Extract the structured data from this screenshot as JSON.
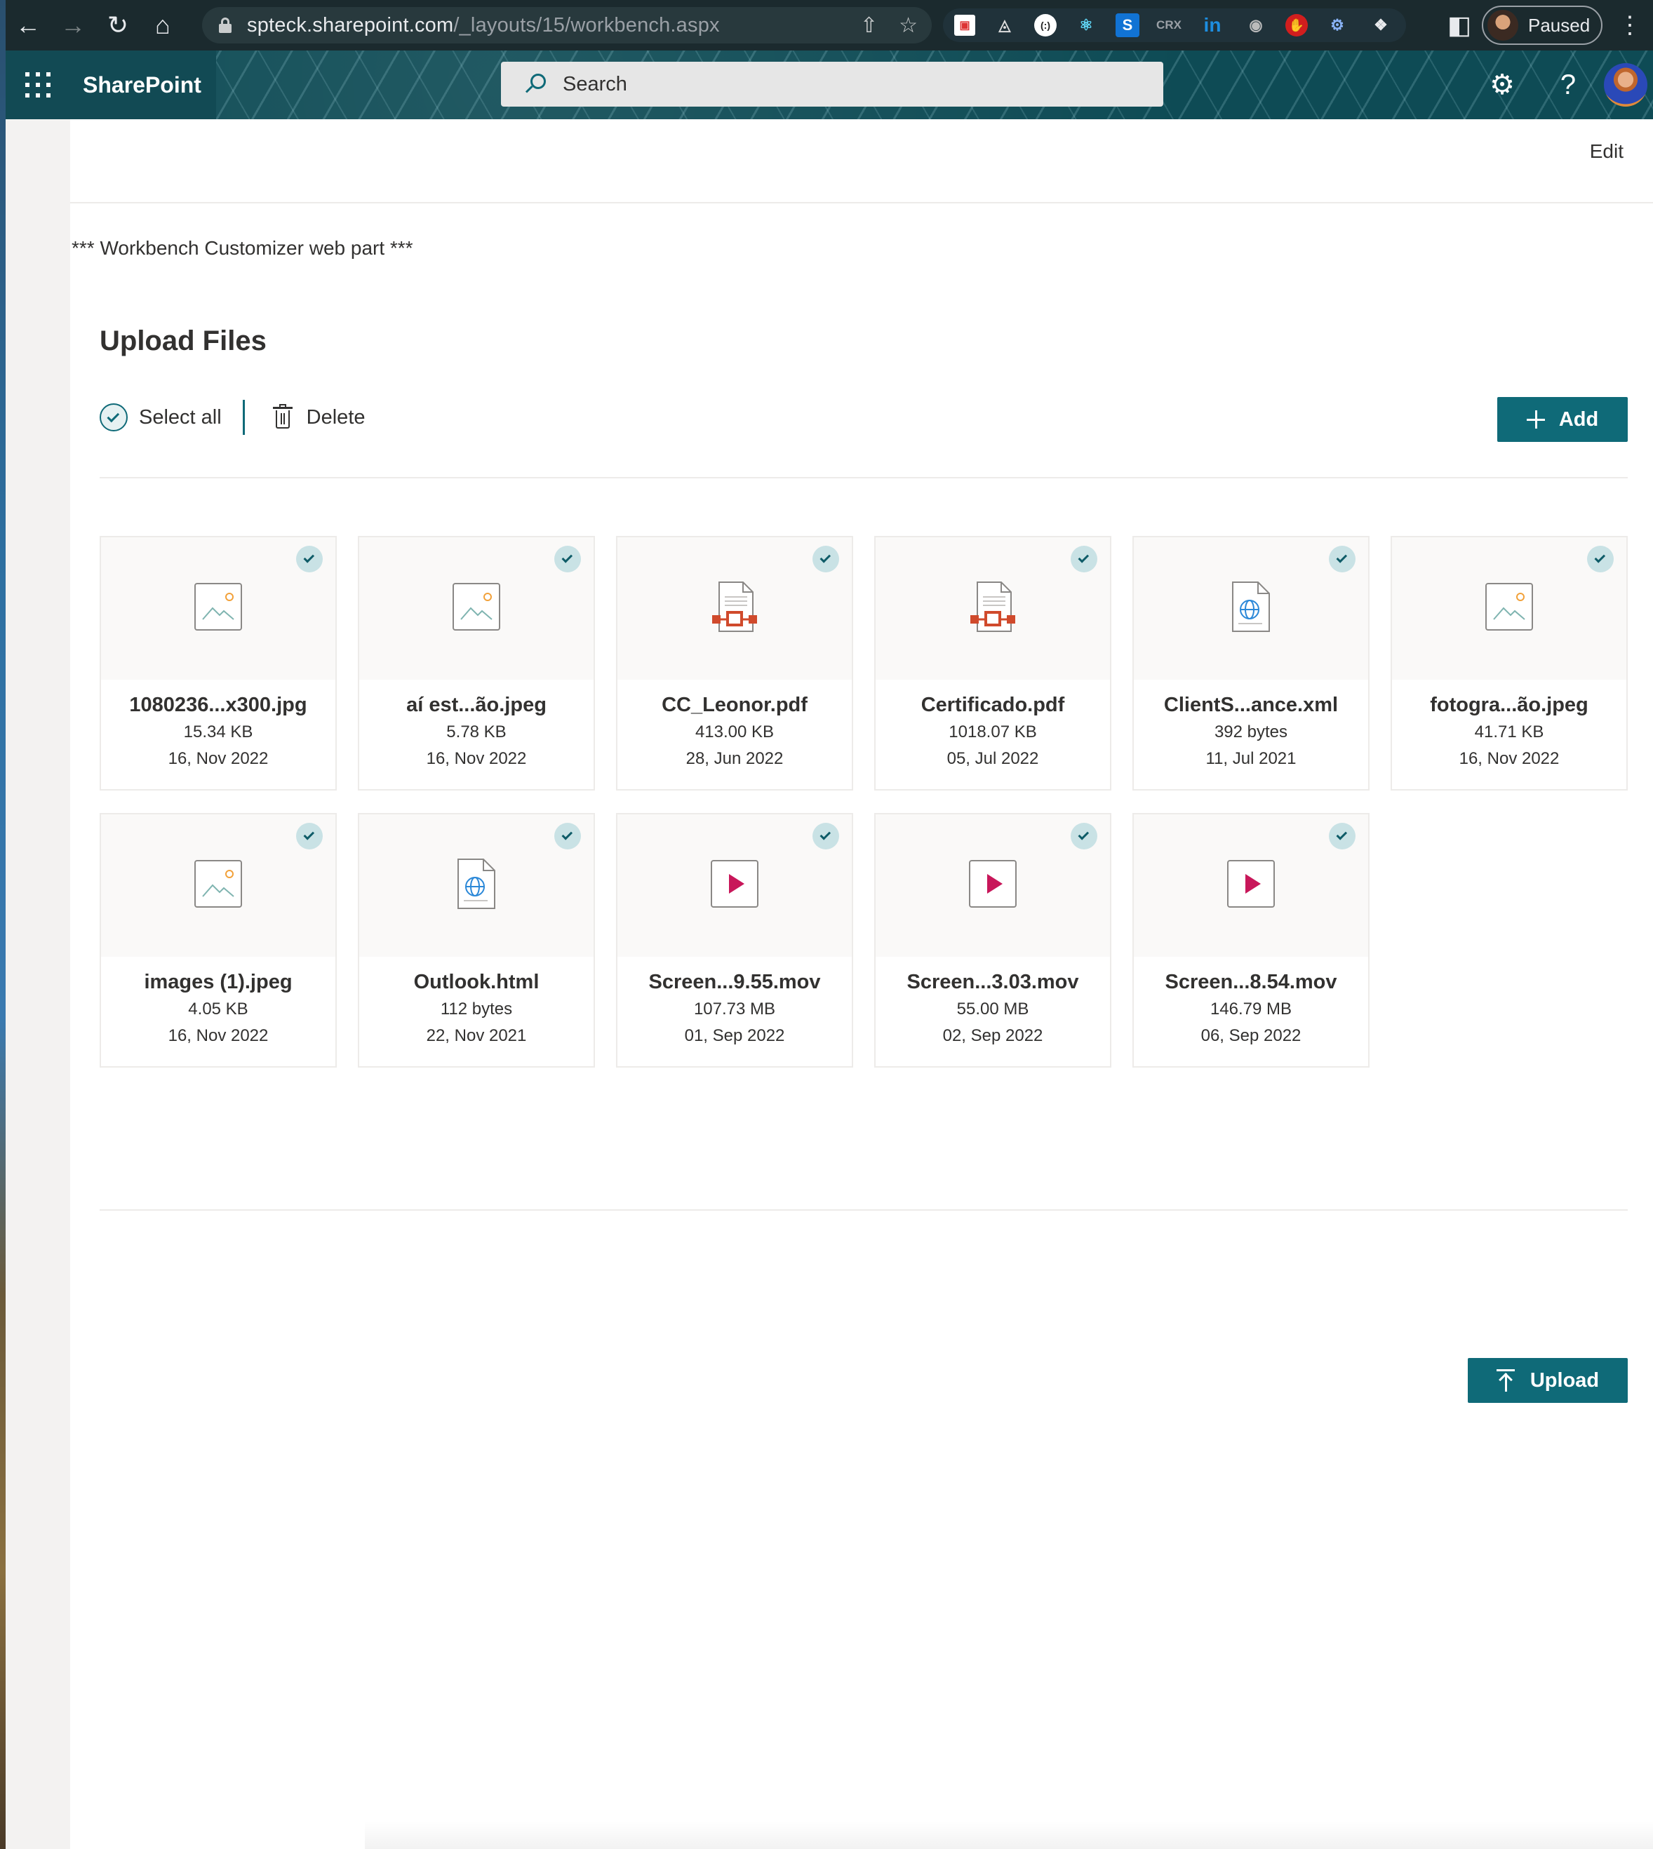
{
  "browser": {
    "url_host": "spteck.sharepoint.com",
    "url_path": "/_layouts/15/workbench.aspx",
    "profile_status": "Paused",
    "extensions": [
      "calendar-ext",
      "mirror-ext",
      "octo-ext",
      "react-devtools",
      "s-ext",
      "crx-ext",
      "linkedin-ext",
      "mask-ext",
      "hand-ext",
      "gear-ext",
      "puzzle-icon",
      "sidebar-icon"
    ]
  },
  "suite": {
    "app_name": "SharePoint",
    "search_placeholder": "Search"
  },
  "workbench": {
    "edit_label": "Edit",
    "caption": "*** Workbench Customizer web part ***"
  },
  "upload": {
    "title": "Upload Files",
    "select_all_label": "Select all",
    "delete_label": "Delete",
    "add_label": "Add",
    "upload_label": "Upload",
    "accent_color": "#0f6a78"
  },
  "files": [
    {
      "name": "1080236...x300.jpg",
      "size": "15.34 KB",
      "date": "16, Nov 2022",
      "type": "image",
      "selected": true
    },
    {
      "name": "aí est...ão.jpeg",
      "size": "5.78 KB",
      "date": "16, Nov 2022",
      "type": "image",
      "selected": true
    },
    {
      "name": "CC_Leonor.pdf",
      "size": "413.00 KB",
      "date": "28, Jun 2022",
      "type": "pdf",
      "selected": true
    },
    {
      "name": "Certificado.pdf",
      "size": "1018.07 KB",
      "date": "05, Jul 2022",
      "type": "pdf",
      "selected": true
    },
    {
      "name": "ClientS...ance.xml",
      "size": "392 bytes",
      "date": "11, Jul 2021",
      "type": "web",
      "selected": true
    },
    {
      "name": "fotogra...ão.jpeg",
      "size": "41.71 KB",
      "date": "16, Nov 2022",
      "type": "image",
      "selected": true
    },
    {
      "name": "images (1).jpeg",
      "size": "4.05 KB",
      "date": "16, Nov 2022",
      "type": "image",
      "selected": true
    },
    {
      "name": "Outlook.html",
      "size": "112 bytes",
      "date": "22, Nov 2021",
      "type": "web",
      "selected": true
    },
    {
      "name": "Screen...9.55.mov",
      "size": "107.73 MB",
      "date": "01, Sep 2022",
      "type": "video",
      "selected": true
    },
    {
      "name": "Screen...3.03.mov",
      "size": "55.00 MB",
      "date": "02, Sep 2022",
      "type": "video",
      "selected": true
    },
    {
      "name": "Screen...8.54.mov",
      "size": "146.79 MB",
      "date": "06, Sep 2022",
      "type": "video",
      "selected": true
    }
  ]
}
